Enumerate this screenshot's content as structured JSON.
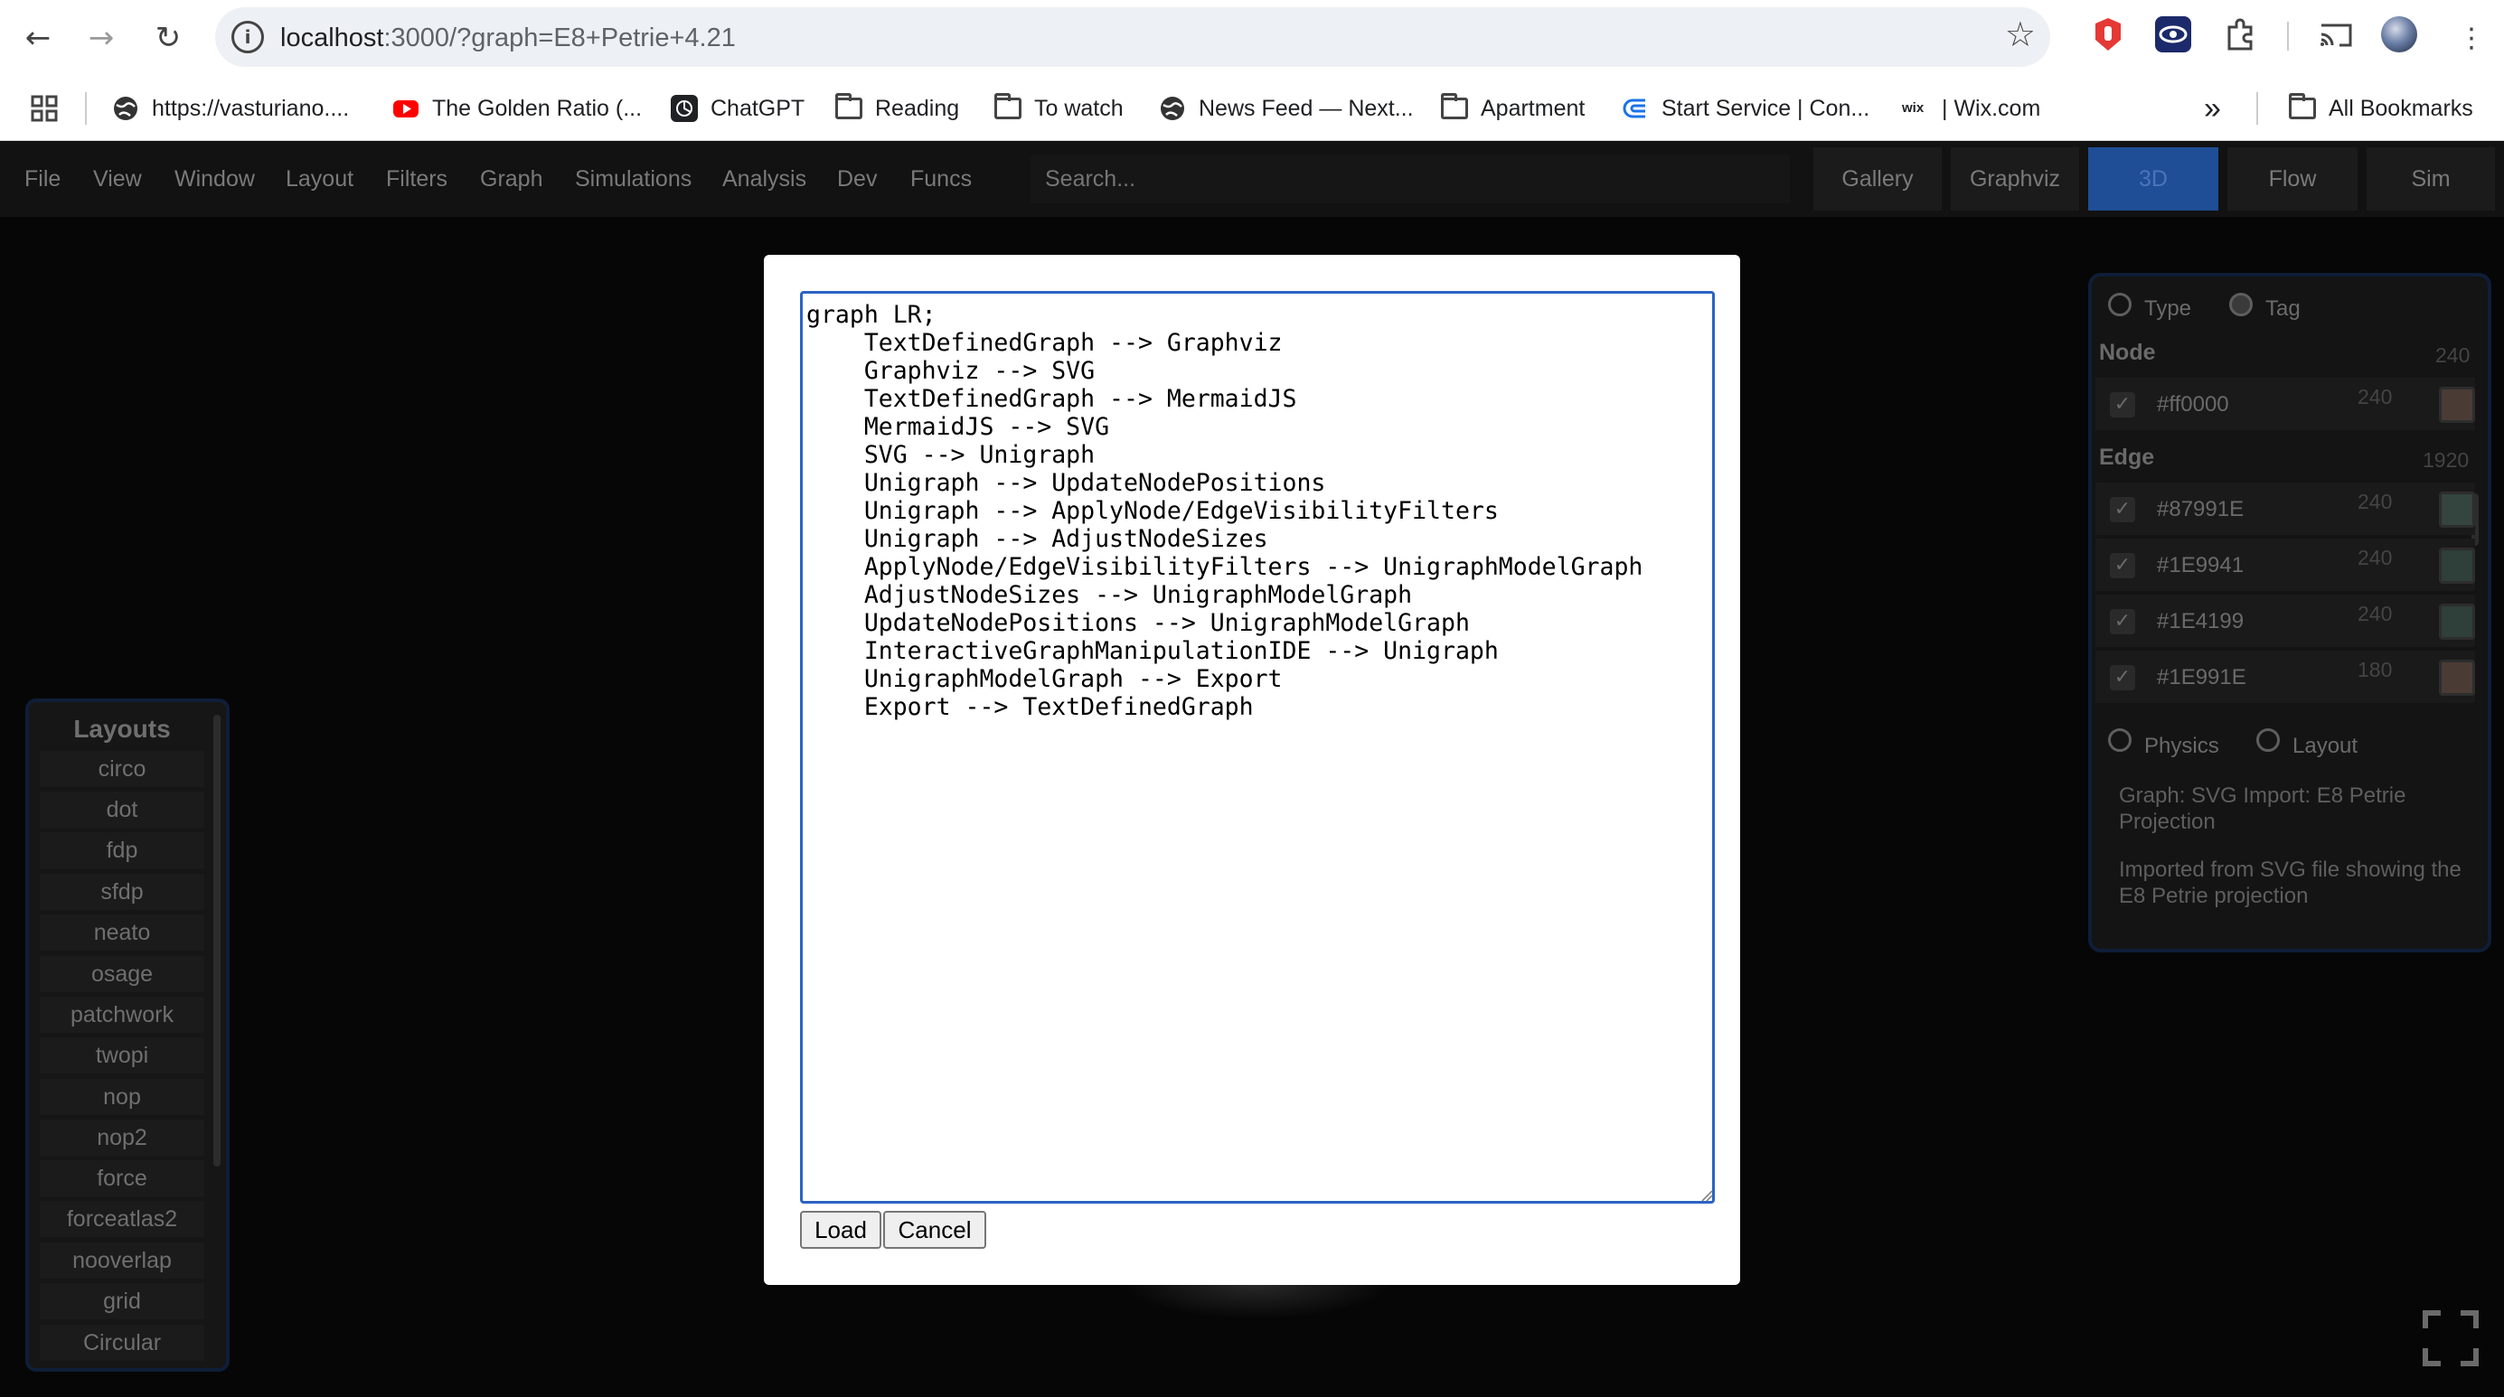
{
  "browser": {
    "url_host": "localhost",
    "url_rest": ":3000/?graph=E8+Petrie+4.21",
    "bookmarks": [
      {
        "label": "https://vasturiano....",
        "icon": "globe-icon"
      },
      {
        "label": "The Golden Ratio (...",
        "icon": "youtube-icon"
      },
      {
        "label": "ChatGPT",
        "icon": "chatgpt-icon"
      },
      {
        "label": "Reading",
        "icon": "folder-icon"
      },
      {
        "label": "To watch",
        "icon": "folder-icon"
      },
      {
        "label": "News Feed — Next...",
        "icon": "globe-icon"
      },
      {
        "label": "Apartment",
        "icon": "folder-icon"
      },
      {
        "label": "Start Service | Con...",
        "icon": "service-icon"
      },
      {
        "label": "| Wix.com",
        "icon": "wix-icon"
      }
    ],
    "overflow_label": "»",
    "all_bookmarks": "All Bookmarks"
  },
  "app": {
    "menu": [
      "File",
      "View",
      "Window",
      "Layout",
      "Filters",
      "Graph",
      "Simulations",
      "Analysis",
      "Dev",
      "Funcs"
    ],
    "search_placeholder": "Search...",
    "view_tabs": [
      {
        "label": "Gallery",
        "active": false
      },
      {
        "label": "Graphviz",
        "active": false
      },
      {
        "label": "3D",
        "active": true
      },
      {
        "label": "Flow",
        "active": false
      },
      {
        "label": "Sim",
        "active": false
      }
    ]
  },
  "layouts_panel": {
    "title": "Layouts",
    "items": [
      "circo",
      "dot",
      "fdp",
      "sfdp",
      "neato",
      "osage",
      "patchwork",
      "twopi",
      "nop",
      "nop2",
      "force",
      "forceatlas2",
      "nooverlap",
      "grid",
      "Circular"
    ]
  },
  "right_panel": {
    "mode_options": [
      "Type",
      "Tag"
    ],
    "selected_mode": "Tag",
    "node_header": "Node",
    "node_count": "240",
    "node_rows": [
      {
        "label": "#ff0000",
        "count": "240",
        "checked": true,
        "swatch": "#4a3c34"
      }
    ],
    "edge_header": "Edge",
    "edge_count": "1920",
    "edge_rows": [
      {
        "label": "#87991E",
        "count": "240",
        "checked": true,
        "swatch": "#34443f"
      },
      {
        "label": "#1E9941",
        "count": "240",
        "checked": true,
        "swatch": "#2f3f3a"
      },
      {
        "label": "#1E4199",
        "count": "240",
        "checked": true,
        "swatch": "#2f3f3a"
      },
      {
        "label": "#1E991E",
        "count": "180",
        "checked": true,
        "swatch": "#4a3c34"
      }
    ],
    "sim_options": [
      "Physics",
      "Layout"
    ],
    "graph_name": "Graph: SVG Import: E8 Petrie Projection",
    "graph_description": "Imported from SVG file showing the E8 Petrie projection"
  },
  "modal": {
    "text": "graph LR;\n    TextDefinedGraph --> Graphviz\n    Graphviz --> SVG\n    TextDefinedGraph --> MermaidJS\n    MermaidJS --> SVG\n    SVG --> Unigraph\n    Unigraph --> UpdateNodePositions\n    Unigraph --> ApplyNode/EdgeVisibilityFilters\n    Unigraph --> AdjustNodeSizes\n    ApplyNode/EdgeVisibilityFilters --> UnigraphModelGraph\n    AdjustNodeSizes --> UnigraphModelGraph\n    UpdateNodePositions --> UnigraphModelGraph\n    InteractiveGraphManipulationIDE --> Unigraph\n    UnigraphModelGraph --> Export\n    Export --> TextDefinedGraph",
    "load_label": "Load",
    "cancel_label": "Cancel"
  }
}
